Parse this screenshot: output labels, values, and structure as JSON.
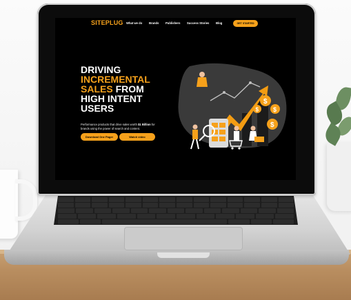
{
  "site": {
    "logo": "SITEPLUG",
    "nav": [
      "What we do",
      "Brands",
      "Publishers",
      "Success Stories",
      "Blog"
    ],
    "cta": "GET STARTED"
  },
  "hero": {
    "line1": "DRIVING",
    "line2": "INCREMENTAL",
    "line3a": "SALES",
    "line3b": " FROM",
    "line4": "HIGH INTENT",
    "line5": "USERS",
    "desc_pre": "Performance products that drive sales worth ",
    "desc_bold": "$1 Billion",
    "desc_post": " for brands using the power of search and content.",
    "primary_button": "Download One Pager",
    "secondary_button": "Watch video"
  },
  "colors": {
    "accent": "#f6a11b",
    "screen_bg": "#000000"
  }
}
